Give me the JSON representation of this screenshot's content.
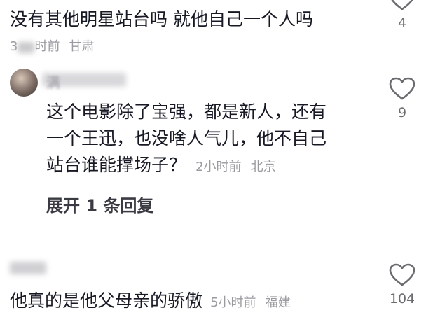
{
  "comment1": {
    "text": "没有其他明星站台吗 就他自己一个人吗",
    "time_prefix": "3",
    "time": "时前",
    "location": "甘肃",
    "likes": "4"
  },
  "reply1": {
    "username": "满",
    "text_lines": [
      "这个电影除了宝强，都是新人，还有",
      "一个王迅，也没啥人气儿，他不自己",
      "站台谁能撑场子？"
    ],
    "time": "2小时前",
    "location": "北京",
    "likes": "9",
    "expand_label": "展开 1 条回复"
  },
  "comment2": {
    "text": "他真的是他父母亲的骄傲",
    "time": "5小时前",
    "location": "福建",
    "likes": "104"
  }
}
